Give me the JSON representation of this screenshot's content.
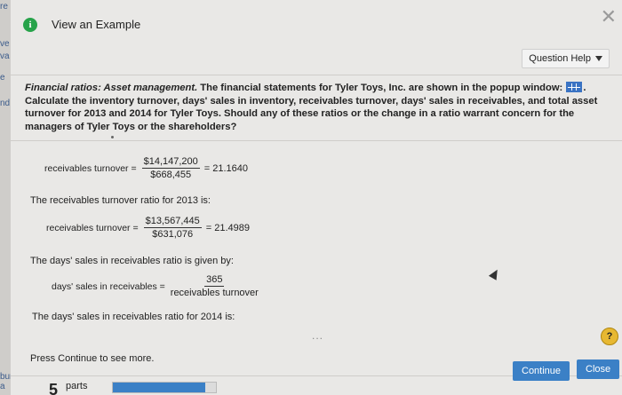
{
  "left_fragments": [
    "re",
    "ve",
    "va",
    "e",
    "nd",
    "bur a"
  ],
  "window": {
    "title": "View an Example",
    "question_help": "Question Help"
  },
  "question": {
    "title": "Financial ratios: Asset management.",
    "text_before_icon": " The financial statements for Tyler Toys, Inc. are shown in the popup window: ",
    "text_after_icon": ". Calculate the inventory turnover, days' sales in inventory, receivables turnover, days' sales in receivables, and total asset turnover for 2013 and 2014 for Tyler Toys. Should any of these ratios or the change in a ratio warrant concern for the managers of Tyler Toys or the shareholders?"
  },
  "example": {
    "formula1": {
      "label": "receivables turnover =",
      "numerator": "$14,147,200",
      "denominator": "$668,455",
      "result": "= 21.1640"
    },
    "line2": "The receivables turnover ratio for 2013 is:",
    "formula2": {
      "label": "receivables turnover =",
      "numerator": "$13,567,445",
      "denominator": "$631,076",
      "result": "= 21.4989"
    },
    "line3": "The days' sales in receivables ratio is given by:",
    "formula3": {
      "label": "days' sales in receivables =",
      "numerator": "365",
      "denominator": "receivables turnover"
    },
    "line4": "The days' sales in receivables ratio for 2014 is:",
    "ellipsis": "...",
    "help_symbol": "?",
    "press_continue": "Press Continue to see more."
  },
  "buttons": {
    "continue": "Continue",
    "close": "Close"
  },
  "footer": {
    "parts_number": "5",
    "parts_label": "parts",
    "progress_fraction": 0.9
  },
  "colors": {
    "accent": "#3b80c6",
    "info_icon": "#27a34a",
    "help_icon": "#e7b832"
  },
  "icons": [
    "info-icon",
    "close-icon",
    "chevron-down-icon",
    "grid-icon",
    "help-icon"
  ]
}
